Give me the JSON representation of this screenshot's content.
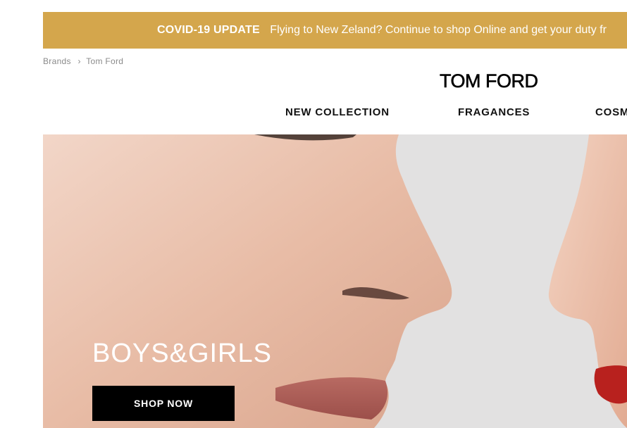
{
  "banner": {
    "strong": "COVID-19 UPDATE",
    "message": "Flying to New Zeland? Continue to shop Online and get your duty fr"
  },
  "breadcrumb": {
    "items": [
      "Brands",
      "Tom Ford"
    ]
  },
  "brand": {
    "logo_text": "TOM FORD"
  },
  "nav": {
    "items": [
      "NEW COLLECTION",
      "FRAGANCES",
      "COSM"
    ]
  },
  "hero": {
    "title": "BOYS&GIRLS",
    "cta_label": "SHOP NOW"
  },
  "colors": {
    "banner_bg": "#d4a64c",
    "cta_bg": "#000000",
    "hero_bg": "#e2e1e1"
  }
}
